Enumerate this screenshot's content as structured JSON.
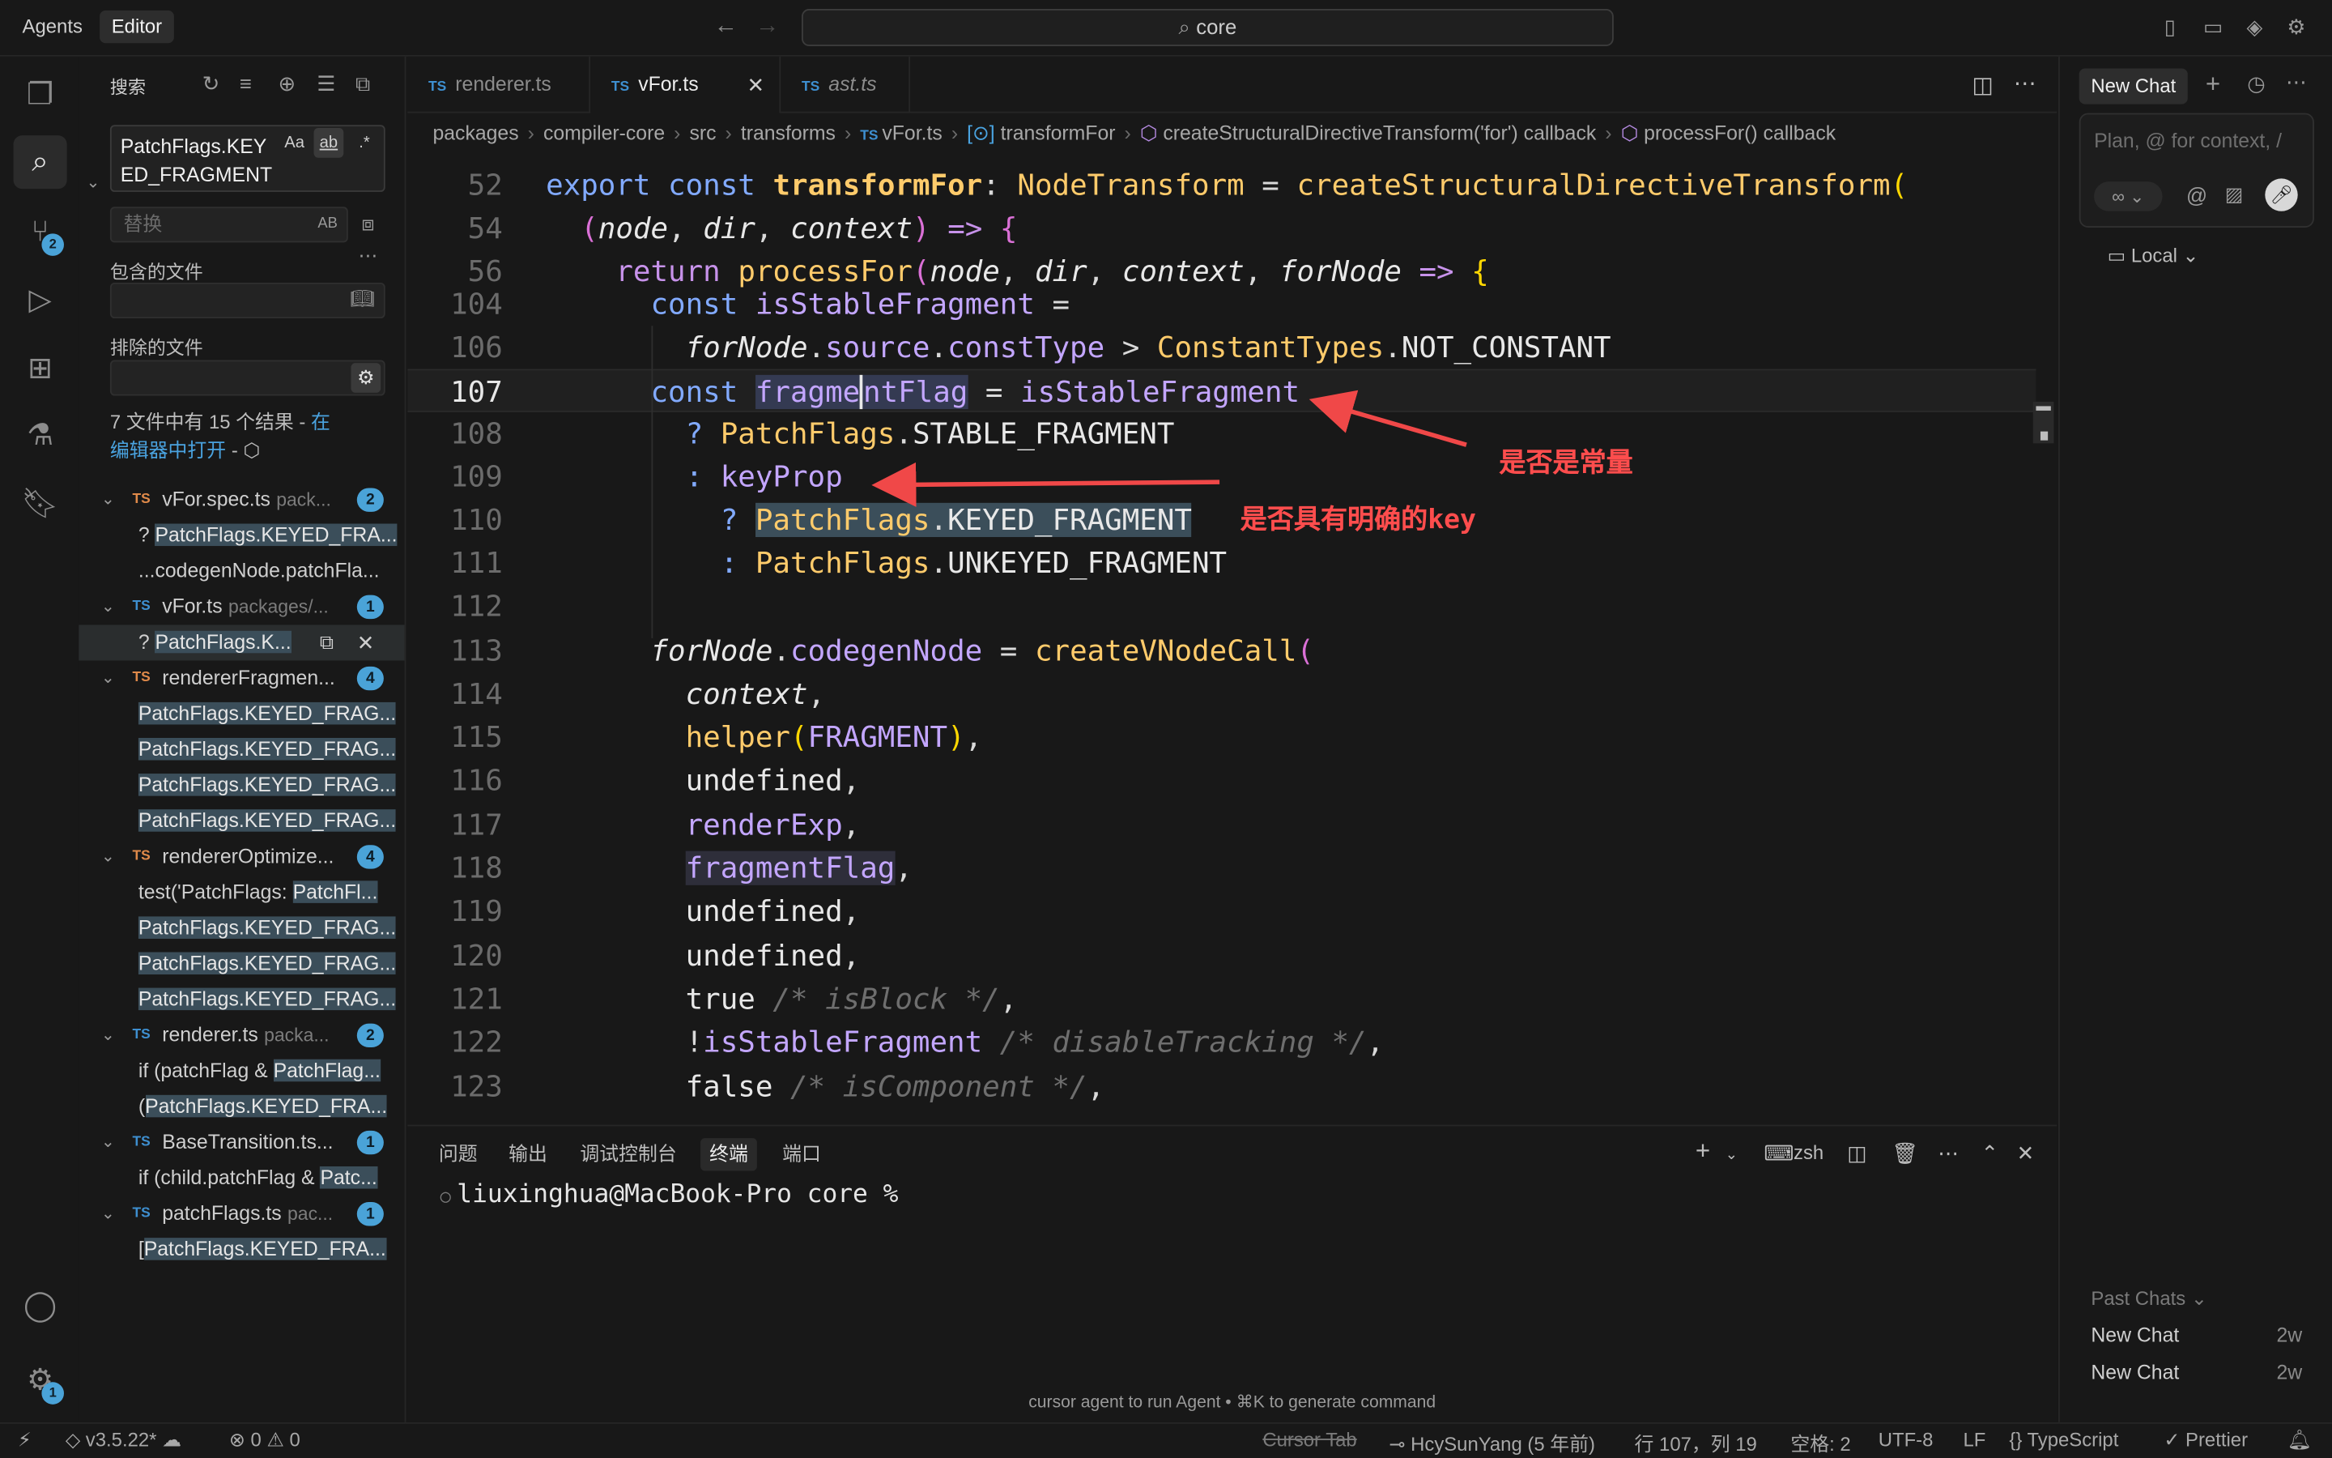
{
  "titlebar": {
    "tab_agents": "Agents",
    "tab_editor": "Editor",
    "command_center": "core"
  },
  "activity": {
    "scm_badge": "2",
    "settings_badge": "1"
  },
  "search": {
    "title": "搜索",
    "query_line1": "PatchFlags.KEY",
    "query_line2": "ED_FRAGMENT",
    "opt_case": "Aa",
    "opt_word": "ab",
    "opt_regex": ".*",
    "replace_placeholder": "替换",
    "replace_opt": "AB",
    "include_label": "包含的文件",
    "exclude_label": "排除的文件",
    "summary_text": "7 文件中有 15 个结果 - ",
    "summary_link1": "在",
    "summary_link2": "编辑器中打开",
    "summary_tail": " - "
  },
  "results": [
    {
      "file": "vFor.spec.ts",
      "path": "pack...",
      "count": "2",
      "color": "or",
      "matches": [
        {
          "pre": "? ",
          "hl": "PatchFlags.KEYED_FRA...",
          "post": ""
        },
        {
          "pre": "...codegenNode.patchFla...",
          "hl": "",
          "post": ""
        }
      ]
    },
    {
      "file": "vFor.ts",
      "path": "packages/...",
      "count": "1",
      "color": "bl",
      "matches": [
        {
          "pre": "? ",
          "hl": "PatchFlags.K...",
          "post": "",
          "selected": true
        }
      ]
    },
    {
      "file": "rendererFragmen...",
      "path": "",
      "count": "4",
      "color": "or",
      "matches": [
        {
          "pre": "",
          "hl": "PatchFlags.KEYED_FRAG...",
          "post": ""
        },
        {
          "pre": "",
          "hl": "PatchFlags.KEYED_FRAG...",
          "post": ""
        },
        {
          "pre": "",
          "hl": "PatchFlags.KEYED_FRAG...",
          "post": ""
        },
        {
          "pre": "",
          "hl": "PatchFlags.KEYED_FRAG...",
          "post": ""
        }
      ]
    },
    {
      "file": "rendererOptimize...",
      "path": "",
      "count": "4",
      "color": "or",
      "matches": [
        {
          "pre": "test('PatchFlags: ",
          "hl": "PatchFl...",
          "post": ""
        },
        {
          "pre": "",
          "hl": "PatchFlags.KEYED_FRAG...",
          "post": ""
        },
        {
          "pre": "",
          "hl": "PatchFlags.KEYED_FRAG...",
          "post": ""
        },
        {
          "pre": "",
          "hl": "PatchFlags.KEYED_FRAG...",
          "post": ""
        }
      ]
    },
    {
      "file": "renderer.ts",
      "path": "packa...",
      "count": "2",
      "color": "bl",
      "matches": [
        {
          "pre": "if (patchFlag & ",
          "hl": "PatchFlag...",
          "post": ""
        },
        {
          "pre": "(",
          "hl": "PatchFlags.KEYED_FRA...",
          "post": ""
        }
      ]
    },
    {
      "file": "BaseTransition.ts...",
      "path": "",
      "count": "1",
      "color": "bl",
      "matches": [
        {
          "pre": "if (child.patchFlag & ",
          "hl": "Patc...",
          "post": ""
        }
      ]
    },
    {
      "file": "patchFlags.ts",
      "path": "pac...",
      "count": "1",
      "color": "bl",
      "matches": [
        {
          "pre": "[",
          "hl": "PatchFlags.KEYED_FRA...",
          "post": ""
        }
      ]
    }
  ],
  "tabs": [
    {
      "label": "renderer.ts",
      "icon": "TS"
    },
    {
      "label": "vFor.ts",
      "icon": "TS",
      "active": true
    },
    {
      "label": "ast.ts",
      "icon": "TS",
      "italic": true
    }
  ],
  "breadcrumb": [
    "packages",
    "compiler-core",
    "src",
    "transforms",
    "vFor.ts",
    "transformFor",
    "createStructuralDirectiveTransform('for') callback",
    "processFor() callback"
  ],
  "code": [
    {
      "n": "52"
    },
    {
      "n": "54"
    },
    {
      "n": "56"
    },
    {
      "n": "104"
    },
    {
      "n": "106"
    },
    {
      "n": "107",
      "current": true
    },
    {
      "n": "108"
    },
    {
      "n": "109"
    },
    {
      "n": "110"
    },
    {
      "n": "111"
    },
    {
      "n": "112"
    },
    {
      "n": "113"
    },
    {
      "n": "114"
    },
    {
      "n": "115"
    },
    {
      "n": "116"
    },
    {
      "n": "117"
    },
    {
      "n": "118"
    },
    {
      "n": "119"
    },
    {
      "n": "120"
    },
    {
      "n": "121"
    },
    {
      "n": "122"
    },
    {
      "n": "123"
    }
  ],
  "annotations": {
    "a1": "是否是常量",
    "a2": "是否具有明确的key"
  },
  "panel": {
    "tabs": [
      "问题",
      "输出",
      "调试控制台",
      "终端",
      "端口"
    ],
    "shell": "zsh",
    "prompt": "liuxinghua@MacBook-Pro core %",
    "hint": "cursor agent to run Agent • ⌘K to generate command"
  },
  "chat": {
    "tab": "New Chat",
    "placeholder": "Plan, @ for context, /",
    "mode": "Local",
    "past_label": "Past Chats",
    "past": [
      {
        "title": "New Chat",
        "age": "2w"
      },
      {
        "title": "New Chat",
        "age": "2w"
      }
    ]
  },
  "status": {
    "version": "v3.5.22*",
    "errors": "0",
    "warnings": "0",
    "cursor_tab": "Cursor Tab",
    "blame": "HcySunYang (5 年前)",
    "position": "行 107，列 19",
    "spaces": "空格: 2",
    "encoding": "UTF-8",
    "eol": "LF",
    "language": "TypeScript",
    "formatter": "Prettier"
  }
}
